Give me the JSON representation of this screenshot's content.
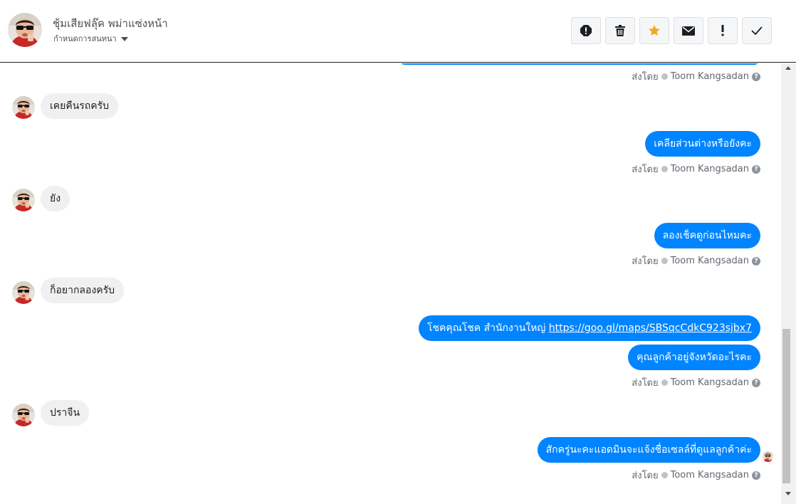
{
  "header": {
    "contact_name": "ชุ้มเสียฟลุ๊ค พม่าแซ่งหน้า",
    "assign_label": "กำหนดการสนทนา",
    "action_icons": [
      "spam-icon",
      "trash-icon",
      "star-icon",
      "envelope-icon",
      "exclamation-icon",
      "check-icon"
    ],
    "accent_star_color": "#f5a623"
  },
  "conversation": {
    "sender_label": "ส่งโดย",
    "agent_name": "Toom Kangsadan",
    "help_glyph": "?",
    "incoming": [
      {
        "text": "เคยคืนรถครับ"
      },
      {
        "text": "ยัง"
      },
      {
        "text": "ก็อยากลองครับ"
      },
      {
        "text": "ปราจีน"
      }
    ],
    "outgoing": [
      {
        "text": "เคลียส่วนต่างหรือยังคะ"
      },
      {
        "text": "ลองเช็คดูก่อนไหมคะ"
      },
      {
        "text_prefix": "โชคคุณโชค สำนักงานใหญ่",
        "link": "https://goo.gl/maps/SBSqcCdkC923sjbx7"
      },
      {
        "text": "คุณลูกค้าอยู่จังหวัดอะไรคะ"
      },
      {
        "text": "สักครู่นะคะแอดมินจะแจ้งชื่อเซลล์ที่ดูแลลูกค้าค่ะ"
      }
    ],
    "colors": {
      "outgoing_bubble": "#0084ff",
      "incoming_bubble": "#f1f0f0"
    }
  }
}
